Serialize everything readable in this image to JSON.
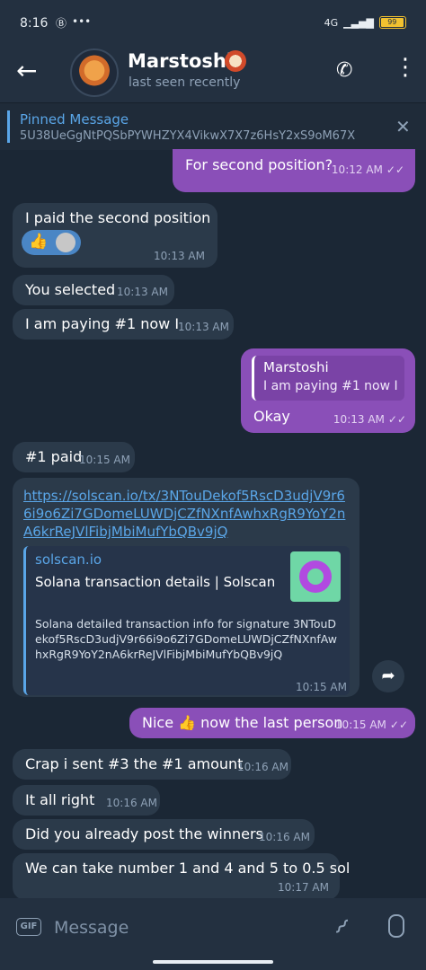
{
  "status_bar": {
    "time": "8:16",
    "network": "4G",
    "battery": "99"
  },
  "header": {
    "back_icon": "arrow-left-icon",
    "contact_name": "Marstoshi",
    "last_seen": "last seen recently"
  },
  "pinned": {
    "title": "Pinned Message",
    "text": "5U38UeGgNtPQSbPYWHZYX4VikwX7X7z6HsY2xS9oM67X"
  },
  "messages": [
    {
      "text": "For second position?",
      "time": "10:12 AM",
      "ticks": "✓✓"
    },
    {
      "text": "I paid the second position",
      "time": "10:13 AM",
      "reaction": "👍"
    },
    {
      "text": "You selected",
      "time": "10:13 AM"
    },
    {
      "text": "I am paying #1 now I",
      "time": "10:13 AM"
    },
    {
      "reply_name": "Marstoshi",
      "reply_text": "I am paying #1 now I",
      "text": "Okay",
      "time": "10:13 AM",
      "ticks": "✓✓"
    },
    {
      "text": "#1 paid",
      "time": "10:15 AM"
    },
    {
      "link": "https://solscan.io/tx/3NTouDekof5RscD3udjV9r66i9o6Zi7GDomeLUWDjCZfNXnfAwhxRgR9YoY2nA6krReJVlFibjMbiMufYbQBv9jQ",
      "preview_site": "solscan.io",
      "preview_title": "Solana transaction details | Solscan",
      "preview_desc": "Solana detailed transaction info for signature 3NTouDekof5RscD3udjV9r66i9o6Zi7GDomeLUWDjCZfNXnfAwhxRgR9YoY2nA6krReJVlFibjMbiMufYbQBv9jQ",
      "time": "10:15 AM"
    },
    {
      "text": "Nice 👍 now the last person",
      "time": "10:15 AM",
      "ticks": "✓✓"
    },
    {
      "text": "Crap i sent #3 the #1 amount",
      "time": "10:16 AM"
    },
    {
      "text": "It all right",
      "time": "10:16 AM"
    },
    {
      "text": "Did you already post the winners",
      "time": "10:16 AM"
    },
    {
      "text": "We can take number 1 and 4 and 5 to 0.5 sol",
      "time": "10:17 AM"
    }
  ],
  "input": {
    "gif_label": "GIF",
    "placeholder": "Message"
  }
}
